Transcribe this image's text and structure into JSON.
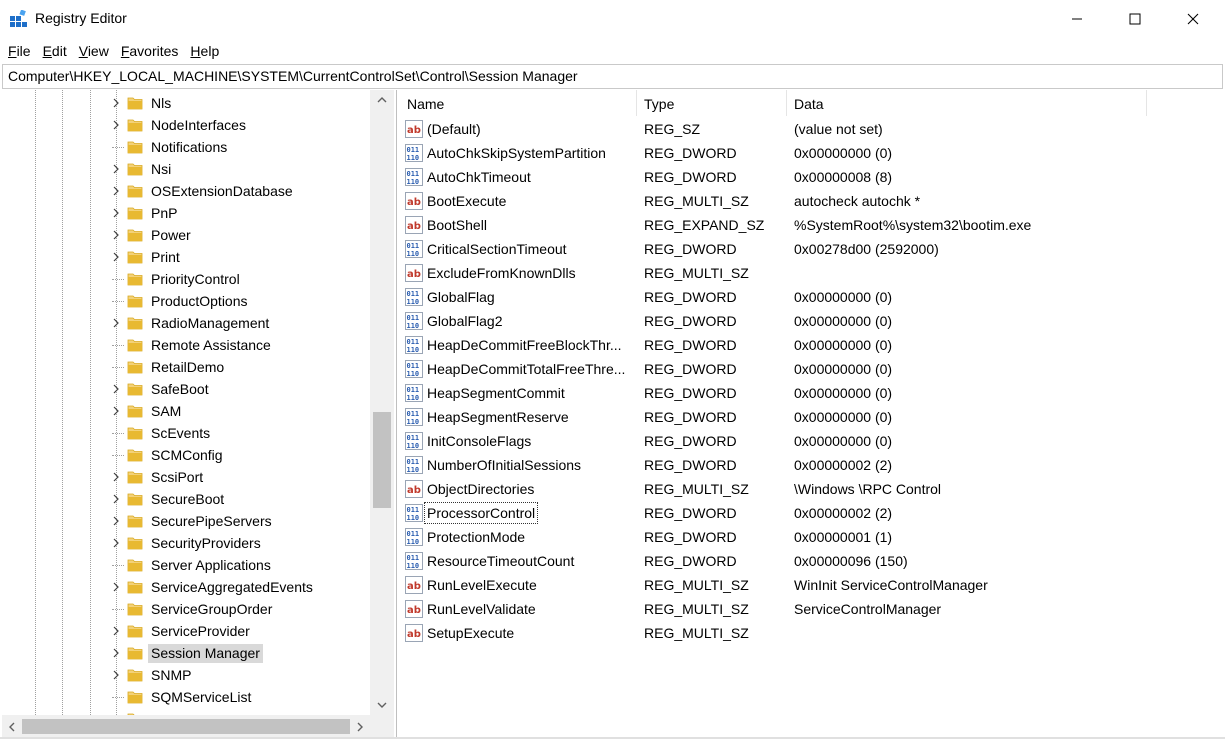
{
  "window": {
    "title": "Registry Editor",
    "controls": [
      "minimize",
      "maximize",
      "close"
    ]
  },
  "menu": [
    {
      "label": "File",
      "accel": "F",
      "rest": "ile"
    },
    {
      "label": "Edit",
      "accel": "E",
      "rest": "dit"
    },
    {
      "label": "View",
      "accel": "V",
      "rest": "iew"
    },
    {
      "label": "Favorites",
      "accel": "F",
      "rest": "avorites"
    },
    {
      "label": "Help",
      "accel": "H",
      "rest": "elp"
    }
  ],
  "address": "Computer\\HKEY_LOCAL_MACHINE\\SYSTEM\\CurrentControlSet\\Control\\Session Manager",
  "tree": {
    "items": [
      {
        "label": "Nls",
        "expandable": true
      },
      {
        "label": "NodeInterfaces",
        "expandable": true
      },
      {
        "label": "Notifications",
        "expandable": false
      },
      {
        "label": "Nsi",
        "expandable": true
      },
      {
        "label": "OSExtensionDatabase",
        "expandable": true
      },
      {
        "label": "PnP",
        "expandable": true
      },
      {
        "label": "Power",
        "expandable": true
      },
      {
        "label": "Print",
        "expandable": true
      },
      {
        "label": "PriorityControl",
        "expandable": false
      },
      {
        "label": "ProductOptions",
        "expandable": false
      },
      {
        "label": "RadioManagement",
        "expandable": true
      },
      {
        "label": "Remote Assistance",
        "expandable": false
      },
      {
        "label": "RetailDemo",
        "expandable": false
      },
      {
        "label": "SafeBoot",
        "expandable": true
      },
      {
        "label": "SAM",
        "expandable": true
      },
      {
        "label": "ScEvents",
        "expandable": false
      },
      {
        "label": "SCMConfig",
        "expandable": false
      },
      {
        "label": "ScsiPort",
        "expandable": true
      },
      {
        "label": "SecureBoot",
        "expandable": true
      },
      {
        "label": "SecurePipeServers",
        "expandable": true
      },
      {
        "label": "SecurityProviders",
        "expandable": true
      },
      {
        "label": "Server Applications",
        "expandable": false
      },
      {
        "label": "ServiceAggregatedEvents",
        "expandable": true
      },
      {
        "label": "ServiceGroupOrder",
        "expandable": false
      },
      {
        "label": "ServiceProvider",
        "expandable": true
      },
      {
        "label": "Session Manager",
        "expandable": true,
        "selected": true
      },
      {
        "label": "SNMP",
        "expandable": true
      },
      {
        "label": "SQMServiceList",
        "expandable": false
      }
    ]
  },
  "list": {
    "columns": [
      "Name",
      "Type",
      "Data"
    ],
    "rows": [
      {
        "name": "(Default)",
        "type": "REG_SZ",
        "data": "(value not set)",
        "icon": "string"
      },
      {
        "name": "AutoChkSkipSystemPartition",
        "type": "REG_DWORD",
        "data": "0x00000000 (0)",
        "icon": "binary"
      },
      {
        "name": "AutoChkTimeout",
        "type": "REG_DWORD",
        "data": "0x00000008 (8)",
        "icon": "binary"
      },
      {
        "name": "BootExecute",
        "type": "REG_MULTI_SZ",
        "data": "autocheck autochk *",
        "icon": "string"
      },
      {
        "name": "BootShell",
        "type": "REG_EXPAND_SZ",
        "data": "%SystemRoot%\\system32\\bootim.exe",
        "icon": "string"
      },
      {
        "name": "CriticalSectionTimeout",
        "type": "REG_DWORD",
        "data": "0x00278d00 (2592000)",
        "icon": "binary"
      },
      {
        "name": "ExcludeFromKnownDlls",
        "type": "REG_MULTI_SZ",
        "data": "",
        "icon": "string"
      },
      {
        "name": "GlobalFlag",
        "type": "REG_DWORD",
        "data": "0x00000000 (0)",
        "icon": "binary"
      },
      {
        "name": "GlobalFlag2",
        "type": "REG_DWORD",
        "data": "0x00000000 (0)",
        "icon": "binary"
      },
      {
        "name": "HeapDeCommitFreeBlockThr...",
        "type": "REG_DWORD",
        "data": "0x00000000 (0)",
        "icon": "binary"
      },
      {
        "name": "HeapDeCommitTotalFreeThre...",
        "type": "REG_DWORD",
        "data": "0x00000000 (0)",
        "icon": "binary"
      },
      {
        "name": "HeapSegmentCommit",
        "type": "REG_DWORD",
        "data": "0x00000000 (0)",
        "icon": "binary"
      },
      {
        "name": "HeapSegmentReserve",
        "type": "REG_DWORD",
        "data": "0x00000000 (0)",
        "icon": "binary"
      },
      {
        "name": "InitConsoleFlags",
        "type": "REG_DWORD",
        "data": "0x00000000 (0)",
        "icon": "binary"
      },
      {
        "name": "NumberOfInitialSessions",
        "type": "REG_DWORD",
        "data": "0x00000002 (2)",
        "icon": "binary"
      },
      {
        "name": "ObjectDirectories",
        "type": "REG_MULTI_SZ",
        "data": "\\Windows \\RPC Control",
        "icon": "string"
      },
      {
        "name": "ProcessorControl",
        "type": "REG_DWORD",
        "data": "0x00000002 (2)",
        "icon": "binary",
        "focused": true
      },
      {
        "name": "ProtectionMode",
        "type": "REG_DWORD",
        "data": "0x00000001 (1)",
        "icon": "binary"
      },
      {
        "name": "ResourceTimeoutCount",
        "type": "REG_DWORD",
        "data": "0x00000096 (150)",
        "icon": "binary"
      },
      {
        "name": "RunLevelExecute",
        "type": "REG_MULTI_SZ",
        "data": "WinInit ServiceControlManager",
        "icon": "string"
      },
      {
        "name": "RunLevelValidate",
        "type": "REG_MULTI_SZ",
        "data": "ServiceControlManager",
        "icon": "string"
      },
      {
        "name": "SetupExecute",
        "type": "REG_MULTI_SZ",
        "data": "",
        "icon": "string"
      }
    ]
  },
  "colors": {
    "folder": "#e8b932",
    "string_icon": "#c0392b",
    "binary_icon": "#2a5db0",
    "selection": "#d9d9d9"
  }
}
